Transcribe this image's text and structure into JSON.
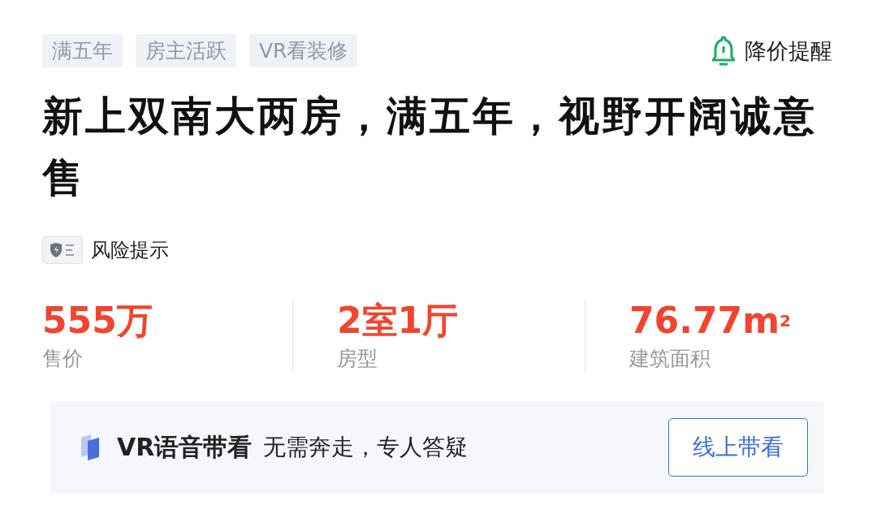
{
  "tags": [
    "满五年",
    "房主活跃",
    "VR看装修"
  ],
  "price_alert": {
    "label": "降价提醒"
  },
  "title": "新上双南大两房，满五年，视野开阔诚意售",
  "risk": {
    "label": "风险提示"
  },
  "stats": [
    {
      "value": "555万",
      "label": "售价"
    },
    {
      "value": "2室1厅",
      "label": "房型"
    },
    {
      "value": "76.77m$^{2}$",
      "label": "建筑面积"
    }
  ],
  "banner": {
    "title": "VR语音带看",
    "subtitle": "无需奔走，专人答疑",
    "button": "线上带看"
  }
}
